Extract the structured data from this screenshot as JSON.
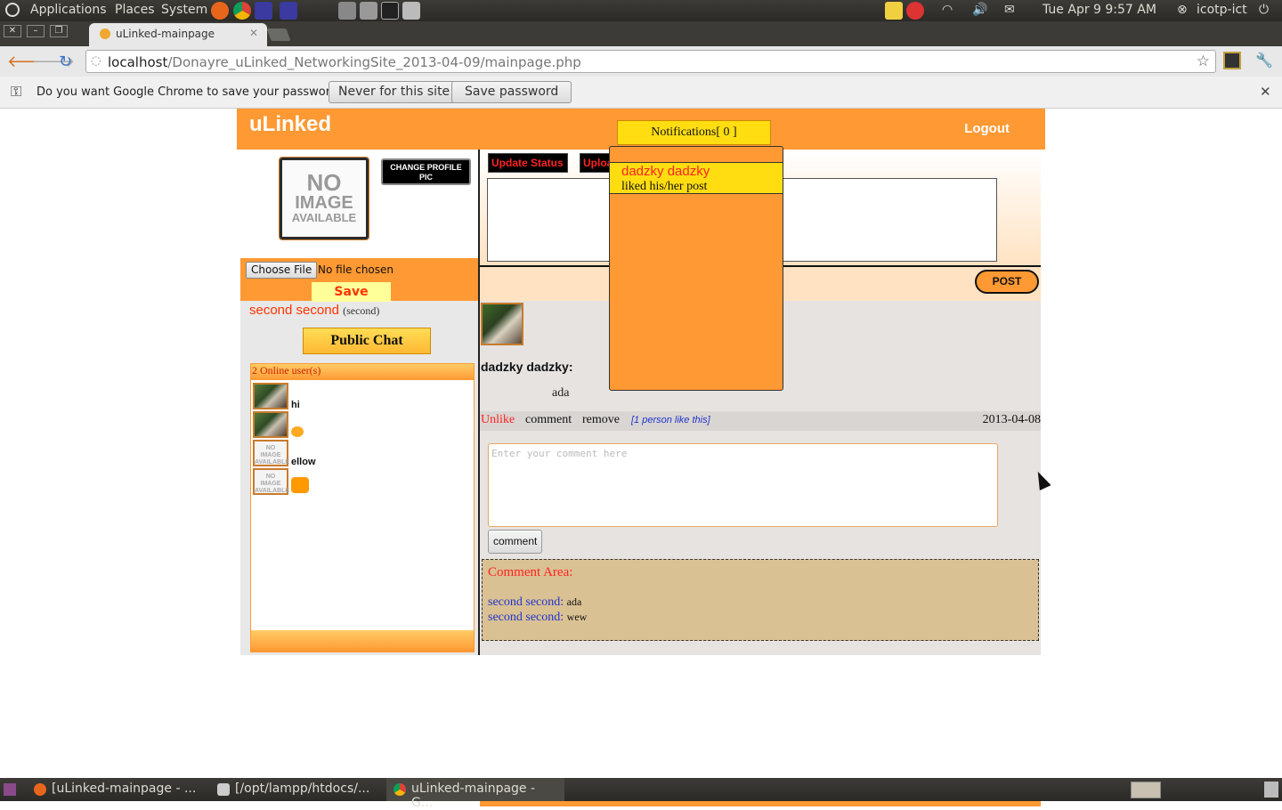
{
  "system_panel": {
    "menus": [
      "Applications",
      "Places",
      "System"
    ],
    "datetime": "Tue Apr 9  9:57 AM",
    "user": "icotp-ict"
  },
  "browser": {
    "tab_title": "uLinked-mainpage",
    "url_host": "localhost",
    "url_path": "/Donayre_uLinked_NetworkingSite_2013-04-09/mainpage.php",
    "password_prompt": "Do you want Google Chrome to save your password?",
    "never_label": "Never for this site",
    "save_label": "Save password"
  },
  "site": {
    "logo": "uLinked",
    "logout": "Logout",
    "notifications_label": "Notifications[ 0 ]",
    "notifications": [
      {
        "name": "dadzky dadzky",
        "text": "liked his/her post"
      }
    ]
  },
  "profile": {
    "noimage_lines": [
      "NO",
      "IMAGE",
      "AVAILABLE"
    ],
    "change_pic_label": "CHANGE PROFILE PIC",
    "choose_file": "Choose File",
    "no_file": "No file chosen",
    "save": "Save",
    "name": "second second",
    "username": "(second)",
    "public_chat": "Public Chat"
  },
  "online": {
    "header": "2 Online user(s)",
    "messages": [
      {
        "text": "hi",
        "avatar": "photo"
      },
      {
        "text": "",
        "avatar": "photo",
        "emoji": true
      },
      {
        "text": "ellow",
        "avatar": "noimage"
      },
      {
        "text": "",
        "avatar": "noimage",
        "emoji": true
      }
    ]
  },
  "status": {
    "update_label": "Update Status",
    "upload_label": "Upload",
    "post_label": "POST"
  },
  "feed": {
    "author": "dadzky dadzky:",
    "content": "ada",
    "unlike": "Unlike",
    "comment": "comment",
    "remove": "remove",
    "likes": "[1 person like this]",
    "date": "2013-04-08",
    "comment_placeholder": "Enter your comment here",
    "comment_button": "comment",
    "comment_area_title": "Comment Area:",
    "comments": [
      {
        "who": "second second:",
        "text": "ada"
      },
      {
        "who": "second second:",
        "text": "wew"
      }
    ]
  },
  "taskbar": {
    "items": [
      "[uLinked-mainpage - ...",
      "[/opt/lampp/htdocs/...",
      "uLinked-mainpage - G..."
    ]
  }
}
